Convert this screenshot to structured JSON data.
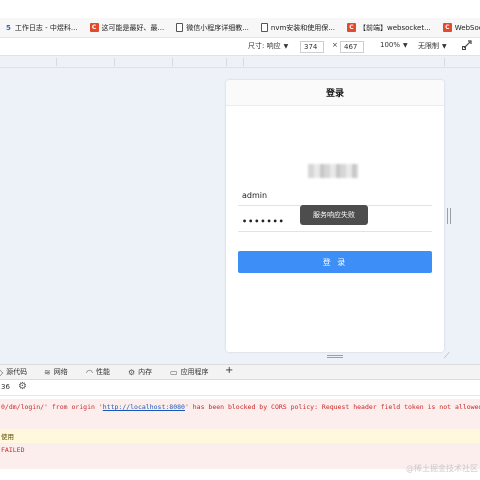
{
  "bookmarks": [
    {
      "cut": "5",
      "label": "工作日志 - 中煜科...",
      "icon": "cut"
    },
    {
      "label": "这可能是最好、最...",
      "icon": "red-c"
    },
    {
      "label": "微信小程序详细教...",
      "icon": "doc"
    },
    {
      "label": "nvm安装和使用保...",
      "icon": "doc"
    },
    {
      "label": "【前端】websocket...",
      "icon": "red-c"
    },
    {
      "label": "WebSocket的使",
      "icon": "red-c"
    }
  ],
  "device_toolbar": {
    "size_label": "尺寸: 响应",
    "width": "374",
    "times": "×",
    "height": "467",
    "zoom": "100%",
    "throttle": "无限制"
  },
  "phone": {
    "title": "登录",
    "username": "admin",
    "password_mask": "•••••••",
    "toast": "服务响应失败",
    "login_button": "登 录"
  },
  "devtools_tabs": [
    "源代码",
    "网络",
    "性能",
    "内存",
    "应用程序"
  ],
  "devtools_add": "+",
  "console": {
    "count": "36",
    "error_line": {
      "prefix": "0/dm/login/' from origin '",
      "link": "http://localhost:8080",
      "suffix": "' has been blocked by CORS policy: Request header field token is not allowed by"
    },
    "warn_line": "使用",
    "failed_line": "FAILED"
  },
  "watermark": "@稀土掘金技术社区",
  "colors": {
    "primary_button": "#3d8ff7",
    "toast_bg": "#4d4d4d",
    "error_bg": "#fdeeee",
    "warn_bg": "#fff8dc",
    "viewport_bg": "#edf1f8"
  }
}
